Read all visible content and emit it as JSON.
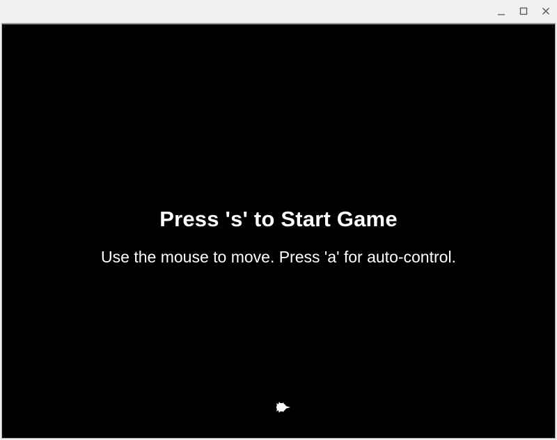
{
  "window": {
    "controls": {
      "minimize_icon": "minimize-icon",
      "maximize_icon": "maximize-icon",
      "close_icon": "close-icon"
    }
  },
  "game": {
    "background_color": "#000000",
    "text_color": "#ffffff",
    "start_prompt": "Press 's' to Start Game",
    "instructions": "Use the mouse to move. Press 'a' for auto-control.",
    "player_icon": "player-ship-icon"
  }
}
